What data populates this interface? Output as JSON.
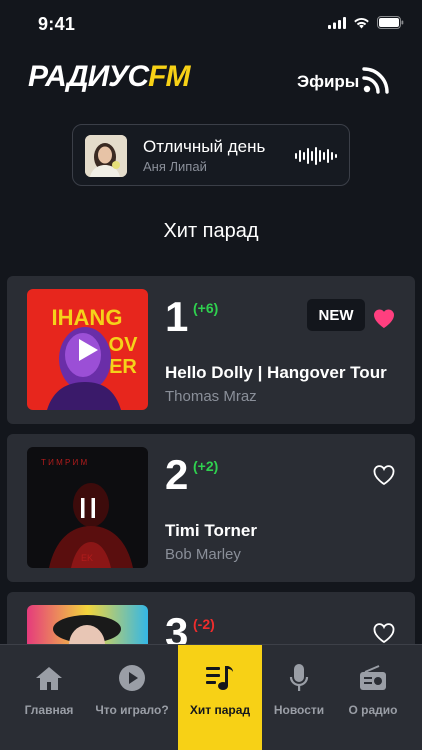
{
  "status": {
    "time": "9:41"
  },
  "header": {
    "logo_main": "РАДИУС",
    "logo_accent": "FM",
    "efiry_label": "Эфиры"
  },
  "now_playing": {
    "title": "Отличный день",
    "artist": "Аня Липай"
  },
  "section": {
    "title": "Хит парад"
  },
  "chart": [
    {
      "rank": "1",
      "delta": "(+6)",
      "direction": "up",
      "title": "Hello Dolly | Hangover Tour",
      "artist": "Thomas Mraz",
      "badge": "NEW",
      "liked": true,
      "state": "paused"
    },
    {
      "rank": "2",
      "delta": "(+2)",
      "direction": "up",
      "title": "Timi Torner",
      "artist": "Bob Marley",
      "badge": "",
      "liked": false,
      "state": "playing"
    },
    {
      "rank": "3",
      "delta": "(-2)",
      "direction": "down",
      "title": "",
      "artist": "",
      "badge": "",
      "liked": false,
      "state": ""
    }
  ],
  "tabs": [
    {
      "label": "Главная",
      "icon": "home-icon"
    },
    {
      "label": "Что играло?",
      "icon": "play-circle-icon"
    },
    {
      "label": "Хит парад",
      "icon": "music-list-icon",
      "active": true
    },
    {
      "label": "Новости",
      "icon": "microphone-icon"
    },
    {
      "label": "О радио",
      "icon": "radio-icon"
    }
  ],
  "colors": {
    "accent": "#f7d116",
    "background": "#13161c",
    "card": "#2a2d34",
    "up": "#2fd14f",
    "down": "#ee2d2d",
    "heart": "#ff3f7f"
  }
}
